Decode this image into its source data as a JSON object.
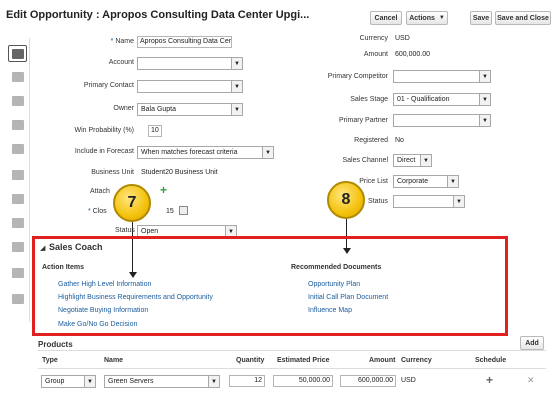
{
  "header": {
    "title": "Edit Opportunity : Apropos Consulting Data Center Upgi...",
    "buttons": {
      "cancel": "Cancel",
      "actions": "Actions",
      "save": "Save",
      "save_close": "Save and Close"
    }
  },
  "form_left": {
    "name": {
      "label": "Name",
      "value": "Apropos Consulting Data Cer"
    },
    "account": {
      "label": "Account",
      "value": ""
    },
    "primary_contact": {
      "label": "Primary Contact",
      "value": ""
    },
    "owner": {
      "label": "Owner",
      "value": "Bala Gupta"
    },
    "win_probability": {
      "label": "Win Probability (%)",
      "value": "10"
    },
    "include_in_forecast": {
      "label": "Include in Forecast",
      "value": "When matches forecast criteria"
    },
    "business_unit": {
      "label": "Business Unit",
      "value": "Student20 Business Unit"
    },
    "attachments": {
      "label": "Attach"
    },
    "close_date": {
      "label": "Clos",
      "value": "15"
    },
    "status": {
      "label": "Status",
      "value": "Open"
    }
  },
  "form_right": {
    "currency": {
      "label": "Currency",
      "value": "USD"
    },
    "amount": {
      "label": "Amount",
      "value": "600,000.00"
    },
    "primary_competitor": {
      "label": "Primary Competitor",
      "value": ""
    },
    "sales_stage": {
      "label": "Sales Stage",
      "value": "01 - Qualification"
    },
    "primary_partner": {
      "label": "Primary Partner",
      "value": ""
    },
    "registered": {
      "label": "Registered",
      "value": "No"
    },
    "sales_channel": {
      "label": "Sales Channel",
      "value": "Direct"
    },
    "price_list": {
      "label": "Price List",
      "value": "Corporate"
    },
    "status_partial": {
      "label": "Status",
      "value": ""
    }
  },
  "callouts": {
    "left": "7",
    "right": "8"
  },
  "sales_coach": {
    "title": "Sales Coach",
    "action_items_title": "Action Items",
    "action_items": [
      "Gather High Level Information",
      "Highlight Business Requirements and Opportunity",
      "Negotiate Buying Information",
      "Make Go/No Go Decision"
    ],
    "recommended_title": "Recommended Documents",
    "recommended": [
      "Opportunity Plan",
      "Initial Call Plan Document",
      "Influence Map"
    ]
  },
  "products": {
    "title": "Products",
    "add_label": "Add",
    "columns": [
      "Type",
      "Name",
      "Quantity",
      "Estimated Price",
      "Amount",
      "Currency",
      "Schedule"
    ],
    "row": {
      "type": "Group",
      "name": "Green Servers",
      "quantity": "12",
      "estimated_price": "50,000.00",
      "amount": "600,000.00",
      "currency": "USD",
      "schedule": "+",
      "remove": "✕"
    }
  },
  "icons": {
    "dropdown": "▼",
    "add": "+",
    "calendar": "calendar-icon"
  },
  "colors": {
    "highlight_border": "#e0201e",
    "link": "#1a5c9e",
    "callout": "#f4c20d",
    "add_icon": "#2e9e3c"
  }
}
